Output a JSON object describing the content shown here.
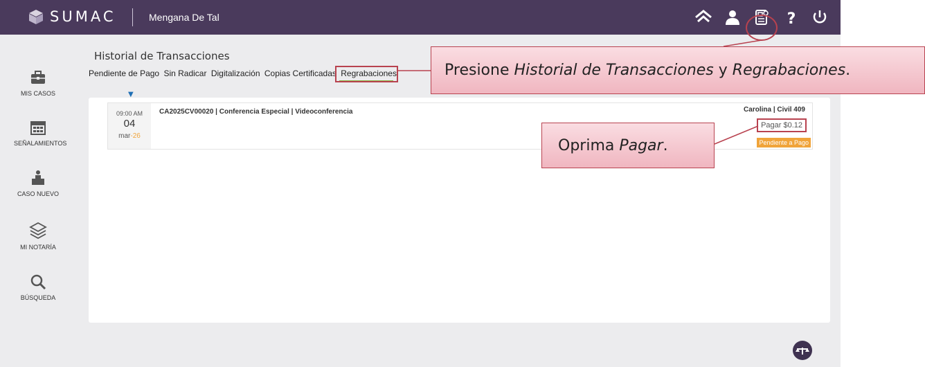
{
  "header": {
    "brand": "SUMAC",
    "user_name": "Mengana De Tal",
    "icons": [
      "home-icon",
      "user-icon",
      "transaction-history-icon",
      "help-icon",
      "power-icon"
    ]
  },
  "sidebar": {
    "items": [
      {
        "label": "MIS CASOS",
        "icon": "briefcase-icon"
      },
      {
        "label": "SEÑALAMIENTOS",
        "icon": "calendar-icon"
      },
      {
        "label": "CASO NUEVO",
        "icon": "new-case-icon"
      },
      {
        "label": "MI NOTARÍA",
        "icon": "layers-icon"
      },
      {
        "label": "BÚSQUEDA",
        "icon": "search-icon"
      }
    ]
  },
  "main": {
    "title": "Historial de Transacciones",
    "tabs": [
      "Pendiente de Pago",
      "Sin Radicar",
      "Digitalización",
      "Copias Certificadas",
      "Regrabaciones"
    ],
    "active_tab": "Regrabaciones",
    "transaction": {
      "time": "09:00 AM",
      "day": "04",
      "month_prefix": "mar",
      "month_suffix": "-26",
      "title": "CA2025CV00020 | Conferencia Especial | Videoconferencia",
      "court": "Carolina | Civil 409",
      "pay_label": "Pagar $0.12",
      "status": "Pendiente a Pago"
    }
  },
  "callouts": {
    "c1_a": "Presione ",
    "c1_b": "Historial de Transacciones",
    "c1_c": " y ",
    "c1_d": "Regrabaciones",
    "c1_e": ".",
    "c2_a": "Oprima ",
    "c2_b": "Pagar",
    "c2_c": "."
  },
  "colors": {
    "topbar": "#4a3a5c",
    "highlight": "#b8424f",
    "status_badge": "#f0a43a",
    "tab_underline": "#8db84a",
    "caret": "#1f6fb5"
  }
}
